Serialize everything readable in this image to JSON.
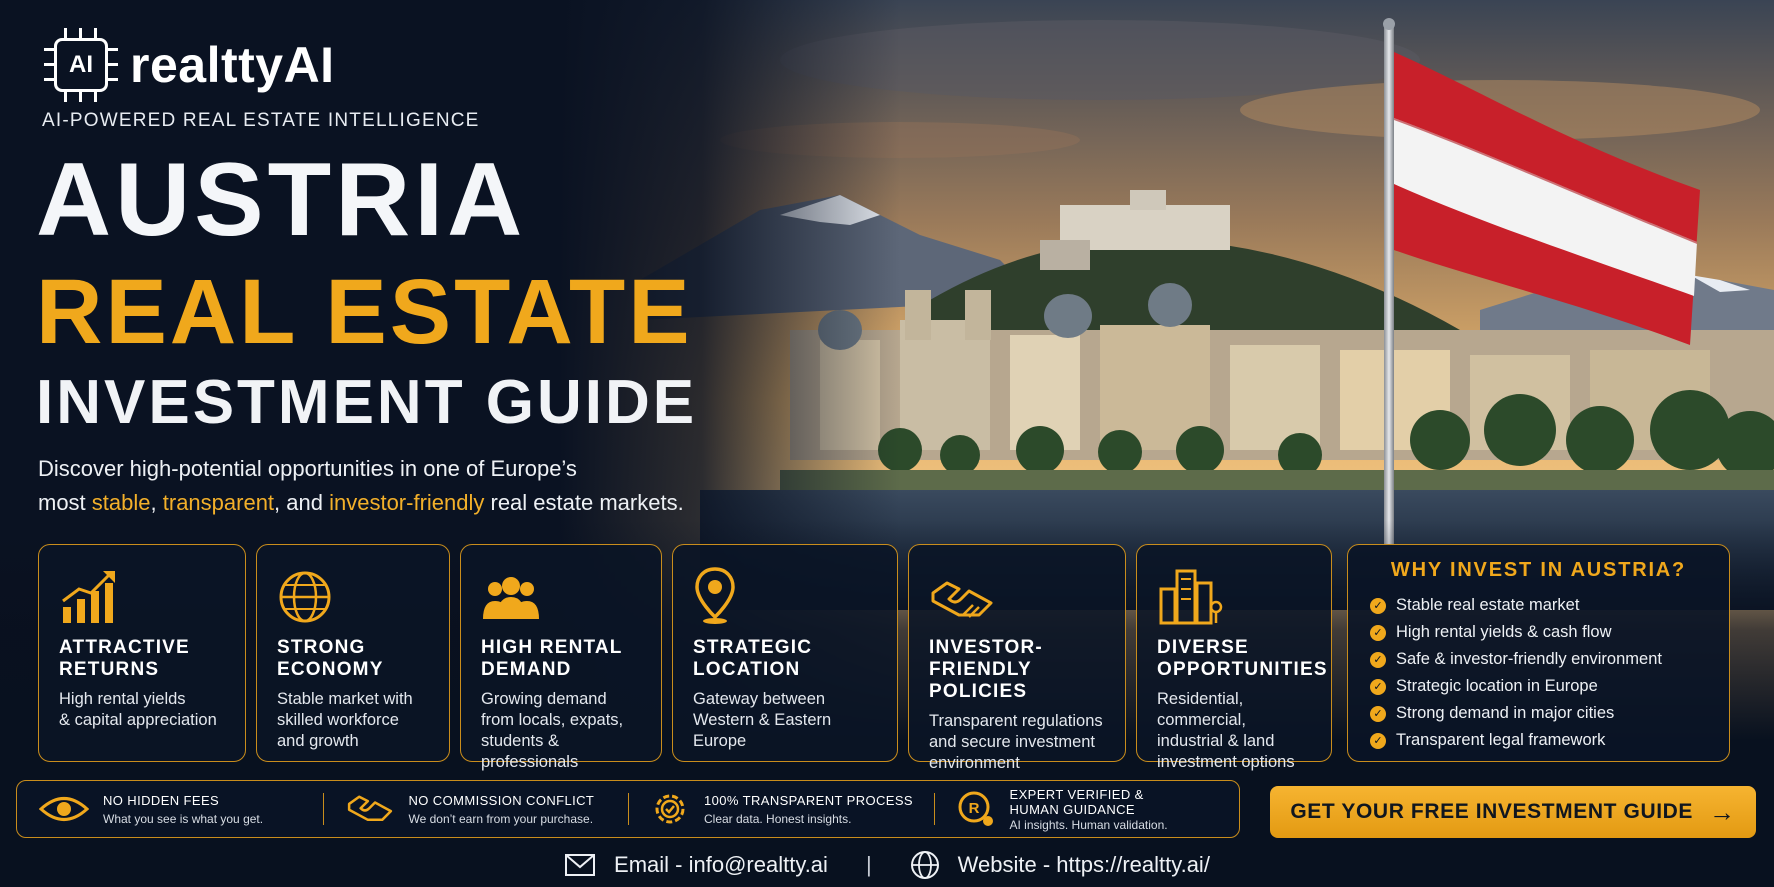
{
  "brand": {
    "chip_text": "AI",
    "name": "realttyAI",
    "tagline": "AI-POWERED REAL ESTATE INTELLIGENCE"
  },
  "headline": {
    "line1": "AUSTRIA",
    "line2": "REAL ESTATE",
    "line3": "INVESTMENT GUIDE"
  },
  "intro": {
    "part1": "Discover high-potential opportunities in one of Europe’s",
    "part2": "most ",
    "hl1": "stable",
    "sep1": ", ",
    "hl2": "transparent",
    "part3": ", and ",
    "hl3": "investor-friendly",
    "part4": " real estate markets."
  },
  "cards": [
    {
      "icon": "chart-growth-icon",
      "title_1": "ATTRACTIVE",
      "title_2": "RETURNS",
      "desc_1": "High rental yields",
      "desc_2": "& capital appreciation",
      "desc_3": "",
      "desc_4": ""
    },
    {
      "icon": "globe-icon",
      "title_1": "STRONG",
      "title_2": "ECONOMY",
      "desc_1": "Stable market with",
      "desc_2": "skilled workforce",
      "desc_3": "and growth",
      "desc_4": ""
    },
    {
      "icon": "people-group-icon",
      "title_1": "HIGH RENTAL",
      "title_2": "DEMAND",
      "desc_1": "Growing demand",
      "desc_2": "from locals, expats,",
      "desc_3": "students &",
      "desc_4": "professionals"
    },
    {
      "icon": "location-pin-icon",
      "title_1": "STRATEGIC",
      "title_2": "LOCATION",
      "desc_1": "Gateway between",
      "desc_2": "Western & Eastern",
      "desc_3": "Europe",
      "desc_4": ""
    },
    {
      "icon": "handshake-icon",
      "title_1": "INVESTOR-",
      "title_2": "FRIENDLY POLICIES",
      "desc_1": "Transparent regulations",
      "desc_2": "and secure investment",
      "desc_3": "environment",
      "desc_4": ""
    },
    {
      "icon": "buildings-icon",
      "title_1": "DIVERSE",
      "title_2": "OPPORTUNITIES",
      "desc_1": "Residential, commercial,",
      "desc_2": "industrial & land",
      "desc_3": "investment options",
      "desc_4": ""
    }
  ],
  "why": {
    "title": "WHY INVEST IN AUSTRIA?",
    "items": [
      "Stable real estate market",
      "High rental yields & cash flow",
      "Safe & investor-friendly environment",
      "Strategic location in Europe",
      "Strong demand in major cities",
      "Transparent legal framework"
    ]
  },
  "trust": [
    {
      "icon": "eye-icon",
      "title": "NO HIDDEN FEES",
      "sub": "What you see is what you get.",
      "sub2": ""
    },
    {
      "icon": "handshake-icon",
      "title": "NO COMMISSION CONFLICT",
      "sub": "We don’t earn from your purchase.",
      "sub2": ""
    },
    {
      "icon": "gear-check-icon",
      "title": "100% TRANSPARENT PROCESS",
      "sub": "Clear data. Honest insights.",
      "sub2": ""
    },
    {
      "icon": "expert-badge-icon",
      "title": "EXPERT VERIFIED &",
      "sub": "HUMAN GUIDANCE",
      "sub2": "AI insights. Human validation."
    }
  ],
  "cta": {
    "label": "GET YOUR FREE INVESTMENT GUIDE",
    "arrow": "→"
  },
  "footer": {
    "email": "Email - info@realtty.ai",
    "sep": "|",
    "website": "Website - https://realtty.ai/"
  },
  "colors": {
    "accent": "#f0a81c",
    "background": "#0b1424",
    "flag_red": "#c8202a",
    "flag_white": "#f3f3f3"
  }
}
